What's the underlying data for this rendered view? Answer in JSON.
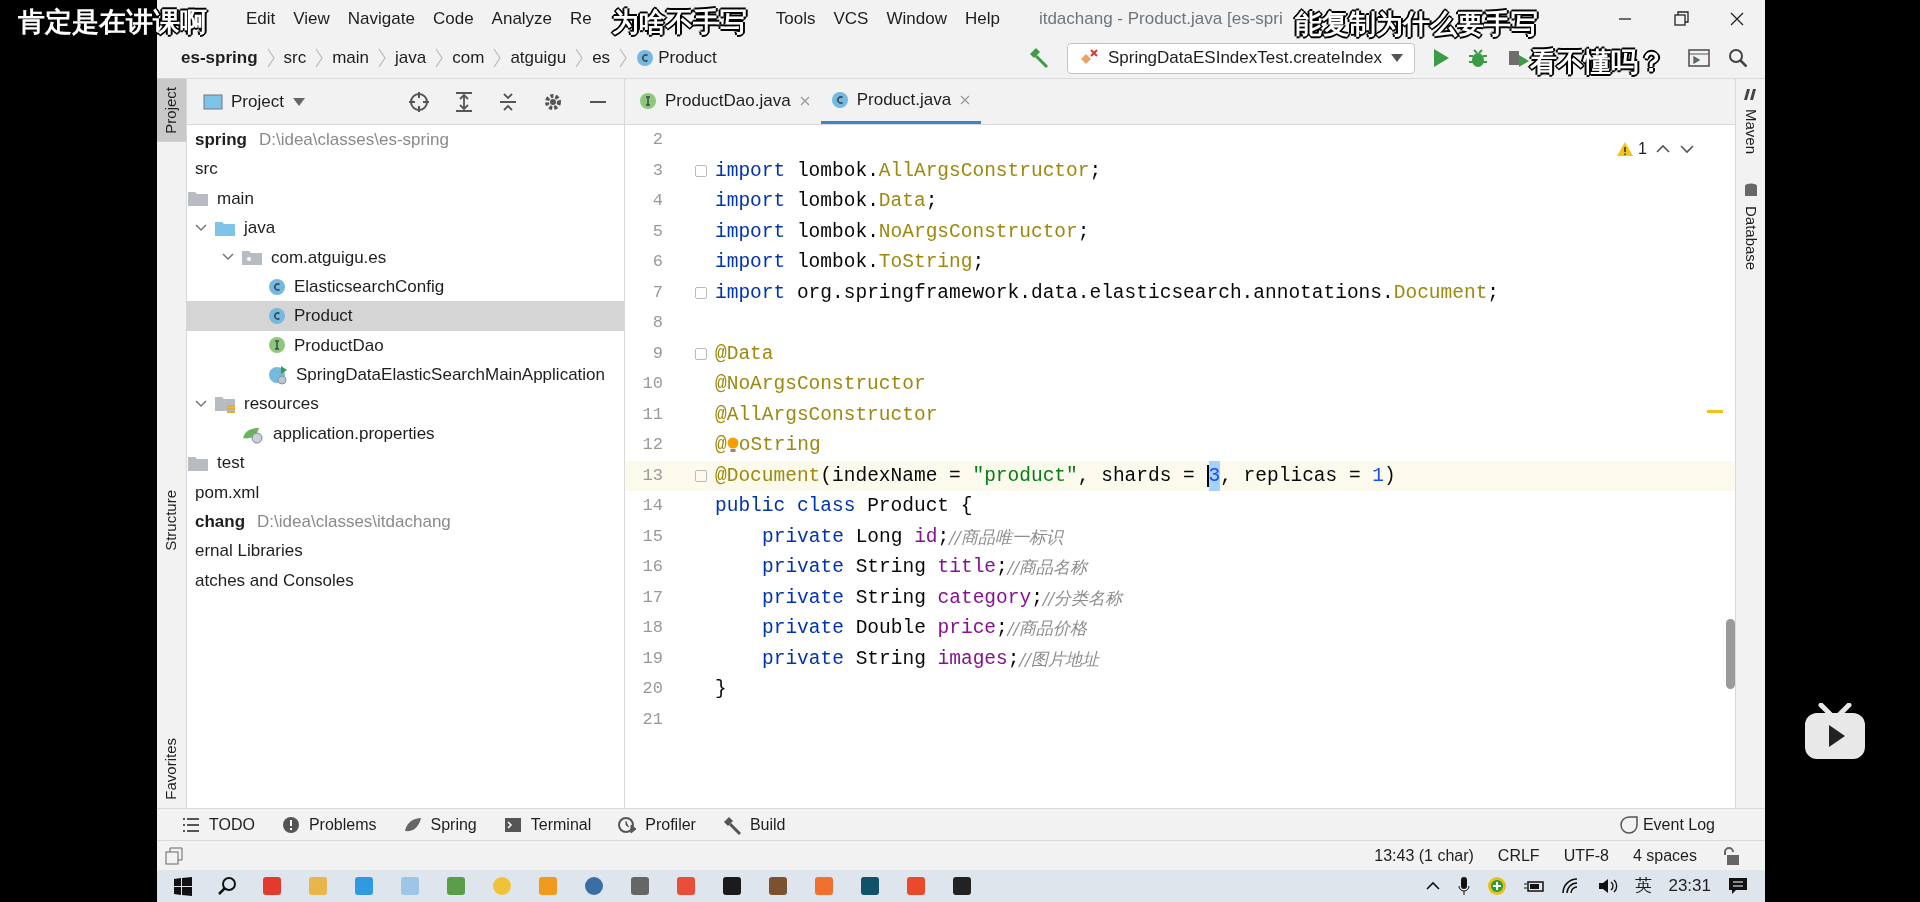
{
  "danmaku": [
    {
      "text": "肯定是在讲课啊"
    },
    {
      "text": "为啥不手写"
    },
    {
      "text": "能复制为什么要手写"
    },
    {
      "text": "看不懂吗？"
    }
  ],
  "menu": [
    "Edit",
    "View",
    "Navigate",
    "Code",
    "Analyze",
    "Re",
    "Tools",
    "VCS",
    "Window",
    "Help"
  ],
  "window": {
    "title": "itdachang - Product.java [es-spri"
  },
  "breadcrumbs": [
    {
      "label": "es-spring",
      "kind": "project"
    },
    {
      "label": "src",
      "kind": "dir"
    },
    {
      "label": "main",
      "kind": "dir"
    },
    {
      "label": "java",
      "kind": "dir"
    },
    {
      "label": "com",
      "kind": "dir"
    },
    {
      "label": "atguigu",
      "kind": "dir"
    },
    {
      "label": "es",
      "kind": "dir"
    },
    {
      "label": "Product",
      "kind": "class"
    }
  ],
  "run_config": "SpringDataESIndexTest.createIndex",
  "left_strip": [
    {
      "label": "Project",
      "selected": true
    },
    {
      "label": "Structure",
      "selected": false
    },
    {
      "label": "Favorites",
      "selected": false
    }
  ],
  "right_strip": [
    "Maven",
    "Database"
  ],
  "project_panel": {
    "title": "Project"
  },
  "tree": [
    {
      "label": "spring",
      "path": "D:\\idea\\classes\\es-spring",
      "kind": "module",
      "selected": false,
      "children": [
        {
          "label": "src",
          "selected": false,
          "children": [
            {
              "label": "main",
              "kind": "folder",
              "selected": false,
              "children": [
                {
                  "label": "java",
                  "kind": "source-folder",
                  "expanded": true,
                  "selected": false,
                  "children": [
                    {
                      "label": "com.atguigu.es",
                      "kind": "package",
                      "expanded": true,
                      "selected": false,
                      "children": [
                        {
                          "label": "ElasticsearchConfig",
                          "kind": "class",
                          "selected": false
                        },
                        {
                          "label": "Product",
                          "kind": "class",
                          "selected": true
                        },
                        {
                          "label": "ProductDao",
                          "kind": "interface",
                          "selected": false
                        },
                        {
                          "label": "SpringDataElasticSearchMainApplication",
                          "kind": "spring-class",
                          "selected": false
                        }
                      ]
                    }
                  ]
                },
                {
                  "label": "resources",
                  "kind": "resource-folder",
                  "expanded": true,
                  "selected": false,
                  "children": [
                    {
                      "label": "application.properties",
                      "kind": "properties",
                      "selected": false
                    }
                  ]
                }
              ]
            },
            {
              "label": "test",
              "kind": "folder",
              "selected": false
            }
          ]
        },
        {
          "label": "pom.xml",
          "selected": false
        }
      ]
    },
    {
      "label": "chang",
      "path": "D:\\idea\\classes\\itdachang",
      "kind": "module",
      "selected": false
    },
    {
      "label": "ernal Libraries",
      "selected": false
    },
    {
      "label": "atches and Consoles",
      "selected": false
    }
  ],
  "editor_tabs": [
    {
      "label": "ProductDao.java",
      "kind": "interface",
      "selected": false
    },
    {
      "label": "Product.java",
      "kind": "class",
      "selected": true
    }
  ],
  "warnings": "1",
  "code_lines": [
    {
      "number": "2",
      "fold": false,
      "current": false
    },
    {
      "number": "3",
      "fold": true,
      "current": false,
      "indented": false,
      "tokens": [
        {
          "kind": "keyword",
          "text": "import "
        },
        {
          "kind": "plain",
          "text": "lombok."
        },
        {
          "kind": "type",
          "text": "AllArgsConstructor"
        },
        {
          "kind": "plain",
          "text": ";"
        }
      ]
    },
    {
      "number": "4",
      "fold": false,
      "current": false,
      "indented": false,
      "tokens": [
        {
          "kind": "keyword",
          "text": "import "
        },
        {
          "kind": "plain",
          "text": "lombok."
        },
        {
          "kind": "type",
          "text": "Data"
        },
        {
          "kind": "plain",
          "text": ";"
        }
      ]
    },
    {
      "number": "5",
      "fold": false,
      "current": false,
      "indented": false,
      "tokens": [
        {
          "kind": "keyword",
          "text": "import "
        },
        {
          "kind": "plain",
          "text": "lombok."
        },
        {
          "kind": "type",
          "text": "NoArgsConstructor"
        },
        {
          "kind": "plain",
          "text": ";"
        }
      ]
    },
    {
      "number": "6",
      "fold": false,
      "current": false,
      "indented": false,
      "tokens": [
        {
          "kind": "keyword",
          "text": "import "
        },
        {
          "kind": "plain",
          "text": "lombok."
        },
        {
          "kind": "type",
          "text": "ToString"
        },
        {
          "kind": "plain",
          "text": ";"
        }
      ]
    },
    {
      "number": "7",
      "fold": true,
      "current": false,
      "indented": false,
      "tokens": [
        {
          "kind": "keyword",
          "text": "import "
        },
        {
          "kind": "plain",
          "text": "org.springframework.data.elasticsearch.annotations."
        },
        {
          "kind": "type",
          "text": "Document"
        },
        {
          "kind": "plain",
          "text": ";"
        }
      ]
    },
    {
      "number": "8",
      "fold": false,
      "current": false
    },
    {
      "number": "9",
      "fold": true,
      "current": false,
      "indented": false,
      "tokens": [
        {
          "kind": "annotation",
          "text": "@Data"
        }
      ]
    },
    {
      "number": "10",
      "fold": false,
      "current": false,
      "indented": false,
      "tokens": [
        {
          "kind": "annotation",
          "text": "@NoArgsConstructor"
        }
      ]
    },
    {
      "number": "11",
      "fold": false,
      "current": false,
      "indented": false,
      "tokens": [
        {
          "kind": "annotation",
          "text": "@AllArgsConstructor"
        }
      ]
    },
    {
      "number": "12",
      "fold": false,
      "current": false,
      "indented": false,
      "tokens": [
        {
          "kind": "annotation",
          "text": "@"
        },
        {
          "kind": "bulb"
        },
        {
          "kind": "annotation",
          "text": "oString"
        }
      ]
    },
    {
      "number": "13",
      "fold": true,
      "current": true,
      "indented": false,
      "tokens": [
        {
          "kind": "annotation",
          "text": "@Document"
        },
        {
          "kind": "plain",
          "text": "(indexName = "
        },
        {
          "kind": "string",
          "text": "\"product\""
        },
        {
          "kind": "plain",
          "text": ", shards = "
        },
        {
          "kind": "caret"
        },
        {
          "kind": "selection",
          "text": "3"
        },
        {
          "kind": "plain",
          "text": ", replicas = "
        },
        {
          "kind": "number",
          "text": "1"
        },
        {
          "kind": "plain",
          "text": ")"
        }
      ]
    },
    {
      "number": "14",
      "fold": false,
      "current": false,
      "indented": false,
      "tokens": [
        {
          "kind": "keyword",
          "text": "public class "
        },
        {
          "kind": "plain",
          "text": "Product {"
        }
      ]
    },
    {
      "number": "15",
      "fold": false,
      "current": false,
      "indented": true,
      "tokens": [
        {
          "kind": "keyword",
          "text": "private "
        },
        {
          "kind": "plain",
          "text": "Long "
        },
        {
          "kind": "field",
          "text": "id"
        },
        {
          "kind": "plain",
          "text": ";"
        },
        {
          "kind": "comment",
          "text": "//商品唯一标识"
        }
      ]
    },
    {
      "number": "16",
      "fold": false,
      "current": false,
      "indented": true,
      "tokens": [
        {
          "kind": "keyword",
          "text": "private "
        },
        {
          "kind": "plain",
          "text": "String "
        },
        {
          "kind": "field",
          "text": "title"
        },
        {
          "kind": "plain",
          "text": ";"
        },
        {
          "kind": "comment",
          "text": "//商品名称"
        }
      ]
    },
    {
      "number": "17",
      "fold": false,
      "current": false,
      "indented": true,
      "tokens": [
        {
          "kind": "keyword",
          "text": "private "
        },
        {
          "kind": "plain",
          "text": "String "
        },
        {
          "kind": "field",
          "text": "category"
        },
        {
          "kind": "plain",
          "text": ";"
        },
        {
          "kind": "comment",
          "text": "//分类名称"
        }
      ]
    },
    {
      "number": "18",
      "fold": false,
      "current": false,
      "indented": true,
      "tokens": [
        {
          "kind": "keyword",
          "text": "private "
        },
        {
          "kind": "plain",
          "text": "Double "
        },
        {
          "kind": "field",
          "text": "price"
        },
        {
          "kind": "plain",
          "text": ";"
        },
        {
          "kind": "comment",
          "text": "//商品价格"
        }
      ]
    },
    {
      "number": "19",
      "fold": false,
      "current": false,
      "indented": true,
      "tokens": [
        {
          "kind": "keyword",
          "text": "private "
        },
        {
          "kind": "plain",
          "text": "String "
        },
        {
          "kind": "field",
          "text": "images"
        },
        {
          "kind": "plain",
          "text": ";"
        },
        {
          "kind": "comment",
          "text": "//图片地址"
        }
      ]
    },
    {
      "number": "20",
      "fold": false,
      "current": false,
      "indented": false,
      "tokens": [
        {
          "kind": "plain",
          "text": "}"
        }
      ]
    },
    {
      "number": "21",
      "fold": false,
      "current": false
    }
  ],
  "tool_windows": [
    {
      "label": "TODO",
      "kind": "todo"
    },
    {
      "label": "Problems",
      "kind": "problems"
    },
    {
      "label": "Spring",
      "kind": "spring"
    },
    {
      "label": "Terminal",
      "kind": "terminal"
    },
    {
      "label": "Profiler",
      "kind": "profiler"
    },
    {
      "label": "Build",
      "kind": "build"
    }
  ],
  "event_log": "Event Log",
  "status_bar": [
    "13:43 (1 char)",
    "CRLF",
    "UTF-8",
    "4 spaces"
  ],
  "tray": {
    "language": "英",
    "time": "23:31"
  }
}
